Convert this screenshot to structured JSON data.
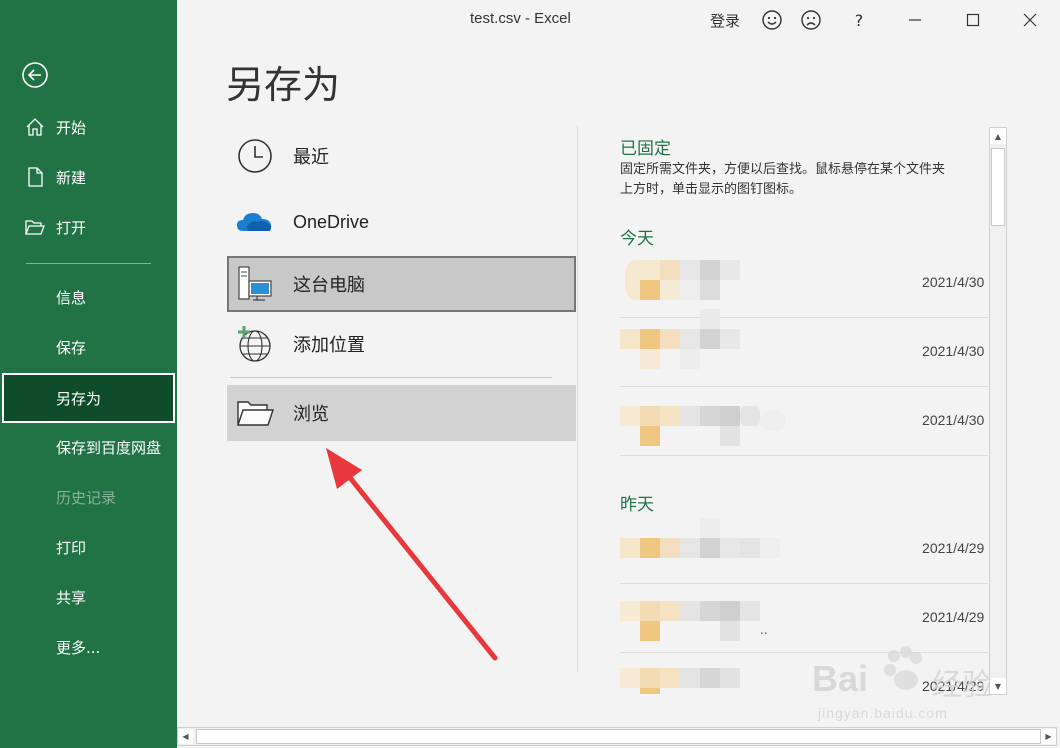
{
  "window": {
    "title": "test.csv  -  Excel",
    "signin": "登录"
  },
  "sidebar": {
    "top_items": [
      {
        "label": "开始",
        "icon": "home-icon"
      },
      {
        "label": "新建",
        "icon": "new-file-icon"
      },
      {
        "label": "打开",
        "icon": "open-folder-icon"
      }
    ],
    "items": [
      {
        "label": "信息"
      },
      {
        "label": "保存"
      },
      {
        "label": "另存为"
      },
      {
        "label": "保存到百度网盘"
      },
      {
        "label": "历史记录"
      },
      {
        "label": "打印"
      },
      {
        "label": "共享"
      },
      {
        "label": "更多..."
      }
    ]
  },
  "page": {
    "title": "另存为"
  },
  "locations": [
    {
      "label": "最近",
      "icon": "clock-icon"
    },
    {
      "label": "OneDrive",
      "icon": "onedrive-cloud-icon"
    },
    {
      "label": "这台电脑",
      "icon": "computer-icon"
    },
    {
      "label": "添加位置",
      "icon": "add-location-globe-icon"
    },
    {
      "label": "浏览",
      "icon": "folder-open-icon"
    }
  ],
  "pinned": {
    "title": "已固定",
    "desc_line1": "固定所需文件夹，方便以后查找。鼠标悬停在某个文件夹",
    "desc_line2": "上方时，单击显示的图钉图标。"
  },
  "today": {
    "title": "今天",
    "rows": [
      {
        "date": "2021/4/30 1"
      },
      {
        "date": "2021/4/30 1"
      },
      {
        "date": "2021/4/30 1"
      }
    ]
  },
  "yesterday": {
    "title": "昨天",
    "rows": [
      {
        "date": "2021/4/29 1"
      },
      {
        "date": "2021/4/29 1"
      },
      {
        "date": "2021/4/29 1"
      }
    ]
  },
  "watermark": {
    "brand": "Bai",
    "brand2": "经验",
    "url": "jingyan.baidu.com"
  },
  "colors": {
    "sidebar": "#217346",
    "sidebar_selected": "#0e4c2a",
    "accent_green": "#217346",
    "arrow_red": "#e8383b"
  }
}
